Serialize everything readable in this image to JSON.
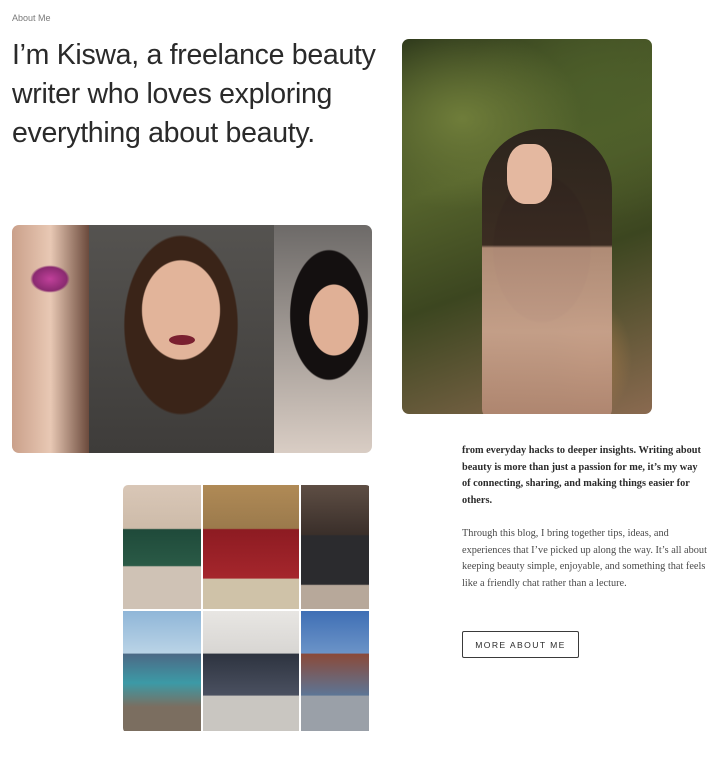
{
  "section": {
    "eyebrow": "About Me",
    "headline": "I’m Kiswa, a freelance beauty writer who loves exploring everything about beauty."
  },
  "about": {
    "paragraph_1": "from everyday hacks to deeper insights. Writing about beauty is more than just a passion for me, it’s my way of connecting, sharing, and making things easier for others.",
    "paragraph_2": "Through this blog, I bring together tips, ideas, and experiences that I’ve picked up along the way. It’s all about keeping beauty simple, enjoyable, and something that feels like a friendly chat rather than a lecture.",
    "button_label": "MORE ABOUT ME"
  }
}
